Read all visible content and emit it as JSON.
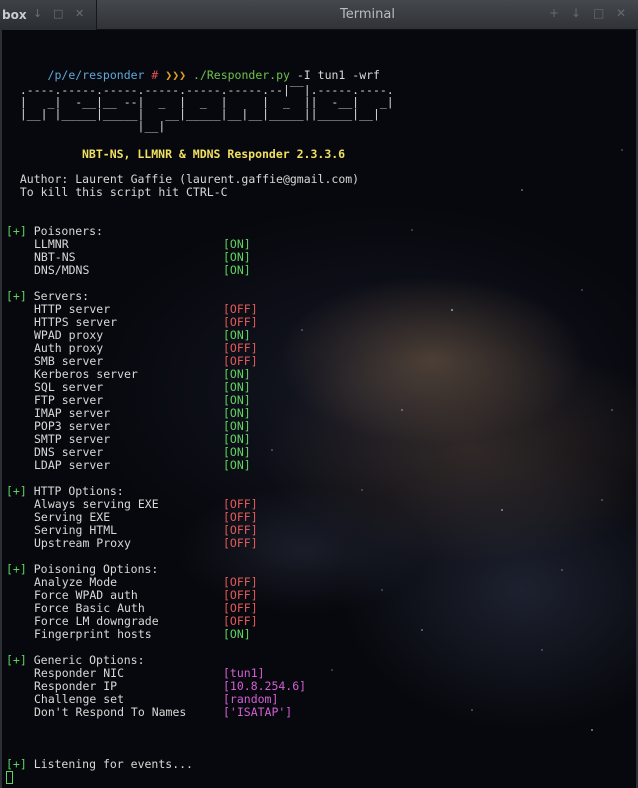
{
  "bg_window": {
    "title": "box",
    "controls": [
      "↓",
      "□",
      "✕"
    ]
  },
  "window": {
    "title": "Terminal",
    "controls": [
      "+",
      "↓",
      "□",
      "✕"
    ]
  },
  "prompt": {
    "path": "/p/e/responder",
    "hash": "#",
    "arrows": "❯❯❯",
    "script": "./Responder.py",
    "args": " -I tun1 -wrf"
  },
  "ascii_art": [
    "                                         __",
    "  .----.-----.-----.-----.-----.-----.--|  |.-----.----.",
    "  |   _|  -__|__ --|  _  |  _  |     |  _  ||  -__|   _|",
    "  |__| |_____|_____|   __|_____|__|__|_____||_____|__|",
    "                   |__|"
  ],
  "banner": "NBT-NS, LLMNR & MDNS Responder 2.3.3.6",
  "author_line": "  Author: Laurent Gaffie (laurent.gaffie@gmail.com)",
  "kill_line": "  To kill this script hit CTRL-C",
  "plus": "[+]",
  "sections": [
    {
      "title": "Poisoners:",
      "items": [
        {
          "label": "LLMNR",
          "value": "[ON]",
          "kind": "on"
        },
        {
          "label": "NBT-NS",
          "value": "[ON]",
          "kind": "on"
        },
        {
          "label": "DNS/MDNS",
          "value": "[ON]",
          "kind": "on"
        }
      ]
    },
    {
      "title": "Servers:",
      "items": [
        {
          "label": "HTTP server",
          "value": "[OFF]",
          "kind": "off"
        },
        {
          "label": "HTTPS server",
          "value": "[OFF]",
          "kind": "off"
        },
        {
          "label": "WPAD proxy",
          "value": "[ON]",
          "kind": "on"
        },
        {
          "label": "Auth proxy",
          "value": "[OFF]",
          "kind": "off"
        },
        {
          "label": "SMB server",
          "value": "[OFF]",
          "kind": "off"
        },
        {
          "label": "Kerberos server",
          "value": "[ON]",
          "kind": "on"
        },
        {
          "label": "SQL server",
          "value": "[ON]",
          "kind": "on"
        },
        {
          "label": "FTP server",
          "value": "[ON]",
          "kind": "on"
        },
        {
          "label": "IMAP server",
          "value": "[ON]",
          "kind": "on"
        },
        {
          "label": "POP3 server",
          "value": "[ON]",
          "kind": "on"
        },
        {
          "label": "SMTP server",
          "value": "[ON]",
          "kind": "on"
        },
        {
          "label": "DNS server",
          "value": "[ON]",
          "kind": "on"
        },
        {
          "label": "LDAP server",
          "value": "[ON]",
          "kind": "on"
        }
      ]
    },
    {
      "title": "HTTP Options:",
      "items": [
        {
          "label": "Always serving EXE",
          "value": "[OFF]",
          "kind": "off"
        },
        {
          "label": "Serving EXE",
          "value": "[OFF]",
          "kind": "off"
        },
        {
          "label": "Serving HTML",
          "value": "[OFF]",
          "kind": "off"
        },
        {
          "label": "Upstream Proxy",
          "value": "[OFF]",
          "kind": "off"
        }
      ]
    },
    {
      "title": "Poisoning Options:",
      "items": [
        {
          "label": "Analyze Mode",
          "value": "[OFF]",
          "kind": "off"
        },
        {
          "label": "Force WPAD auth",
          "value": "[OFF]",
          "kind": "off"
        },
        {
          "label": "Force Basic Auth",
          "value": "[OFF]",
          "kind": "off"
        },
        {
          "label": "Force LM downgrade",
          "value": "[OFF]",
          "kind": "off"
        },
        {
          "label": "Fingerprint hosts",
          "value": "[ON]",
          "kind": "on"
        }
      ]
    },
    {
      "title": "Generic Options:",
      "items": [
        {
          "label": "Responder NIC",
          "value": "[tun1]",
          "kind": "val"
        },
        {
          "label": "Responder IP",
          "value": "[10.8.254.6]",
          "kind": "val"
        },
        {
          "label": "Challenge set",
          "value": "[random]",
          "kind": "val"
        },
        {
          "label": "Don't Respond To Names",
          "value": "['ISATAP']",
          "kind": "val"
        }
      ]
    }
  ],
  "listening": "Listening for events...",
  "colors": {
    "on": "#5fd35f",
    "off": "#e05a5a",
    "value": "#d45fd4",
    "banner": "#f0e060",
    "path": "#5fa8d9"
  }
}
